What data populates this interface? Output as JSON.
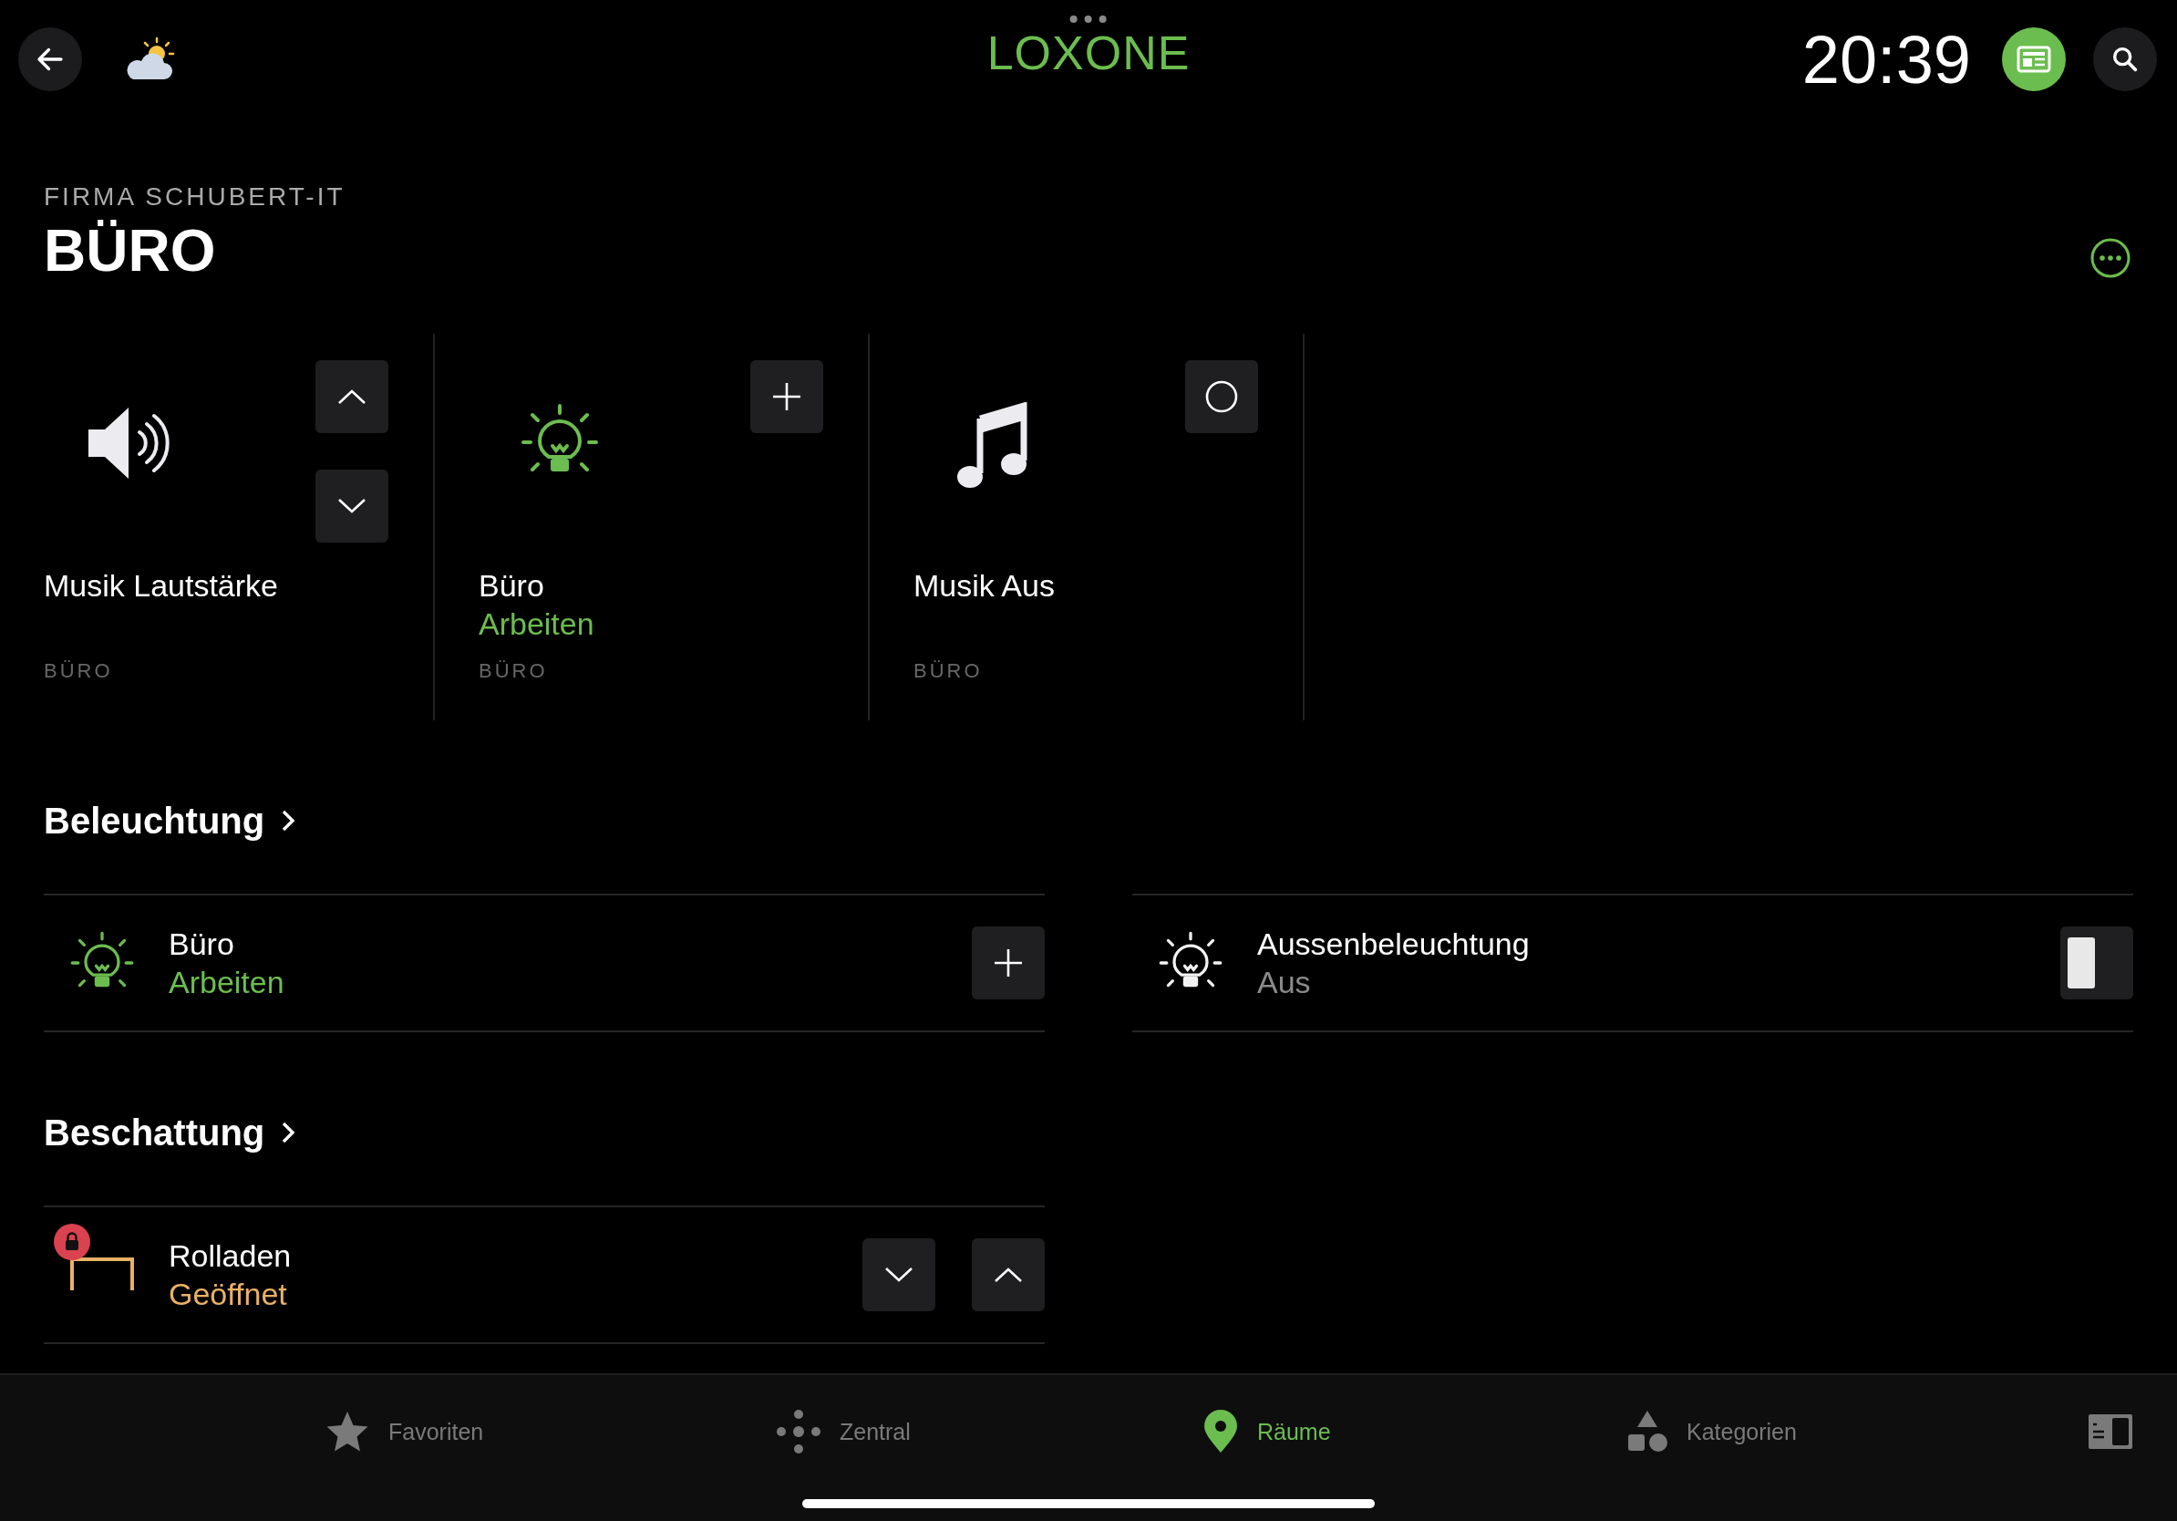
{
  "top_bar": {
    "logo": "LOXONE",
    "time": "20:39"
  },
  "header": {
    "location": "FIRMA SCHUBERT-IT",
    "room": "BÜRO"
  },
  "tiles": [
    {
      "kind": "volume",
      "title": "Musik Lautstärke",
      "room": "BÜRO"
    },
    {
      "kind": "light",
      "title": "Büro",
      "status": "Arbeiten",
      "room": "BÜRO"
    },
    {
      "kind": "music",
      "title": "Musik Aus",
      "room": "BÜRO"
    }
  ],
  "sections": [
    {
      "title": "Beleuchtung",
      "rows": [
        {
          "kind": "light",
          "name": "Büro",
          "status": "Arbeiten",
          "on": true
        },
        {
          "kind": "switch-light",
          "name": "Aussenbeleuchtung",
          "status": "Aus",
          "on": false
        }
      ]
    },
    {
      "title": "Beschattung",
      "rows": [
        {
          "kind": "blind",
          "name": "Rolladen",
          "status": "Geöffnet",
          "locked": true
        }
      ]
    }
  ],
  "tab_bar": [
    {
      "kind": "favorites",
      "label": "Favoriten",
      "selected": false
    },
    {
      "kind": "central",
      "label": "Zentral",
      "selected": false
    },
    {
      "kind": "rooms",
      "label": "Räume",
      "selected": true
    },
    {
      "kind": "categories",
      "label": "Kategorien",
      "selected": false
    }
  ]
}
